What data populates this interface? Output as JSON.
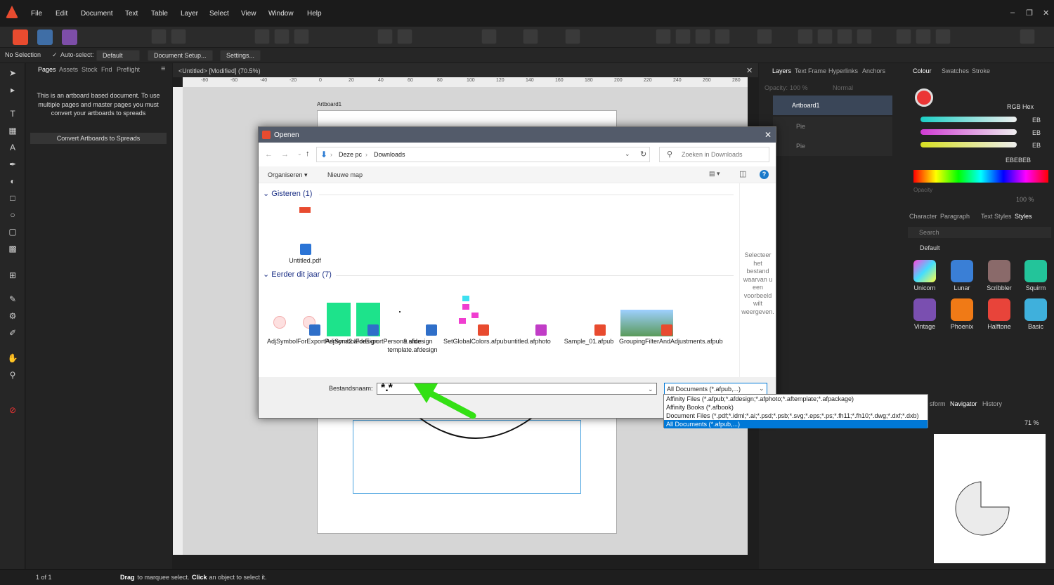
{
  "menu": [
    "File",
    "Edit",
    "Document",
    "Text",
    "Table",
    "Layer",
    "Select",
    "View",
    "Window",
    "Help"
  ],
  "context": {
    "status": "No Selection",
    "auto_select_label": "Auto-select:",
    "auto_select_value": "Default",
    "doc_setup": "Document Setup...",
    "settings": "Settings..."
  },
  "pages_panel": {
    "tabs": [
      "Pages",
      "Assets",
      "Stock",
      "Fnd",
      "Preflight"
    ],
    "info": "This is an artboard based document. To use multiple pages and master pages you must convert your artboards to spreads",
    "convert": "Convert Artboards to Spreads"
  },
  "canvas": {
    "doc_tab": "<Untitled> [Modified] (70.5%)",
    "artboard_label": "Artboard1"
  },
  "ruler_ticks": [
    "-80",
    "-60",
    "-40",
    "-20",
    "0",
    "20",
    "40",
    "60",
    "80",
    "100",
    "120",
    "140",
    "160",
    "180",
    "200",
    "220",
    "240",
    "260",
    "280"
  ],
  "layers_panel": {
    "tabs": [
      "Layers",
      "Text Frame",
      "Hyperlinks",
      "Anchors"
    ],
    "opacity_label": "Opacity:",
    "opacity_value": "100 %",
    "blend": "Normal",
    "items": [
      "Artboard1",
      "Pie",
      "Pie"
    ]
  },
  "colour_panel": {
    "tabs": [
      "Colour",
      "Swatches",
      "Stroke"
    ],
    "mode": "RGB Hex",
    "r": "EB",
    "g": "EB",
    "b": "EB",
    "hex": "EBEBEB",
    "opacity_label": "Opacity",
    "opacity_value": "100 %"
  },
  "styles_panel": {
    "tabs": [
      "Character",
      "Paragraph",
      "Text Styles",
      "Styles"
    ],
    "search_placeholder": "Search",
    "category": "Default",
    "items": [
      "Unicorn",
      "Lunar",
      "Scribbler",
      "Squirm",
      "Vintage",
      "Phoenix",
      "Halftone",
      "Basic"
    ]
  },
  "navigator_panel": {
    "tabs": [
      "sform",
      "Navigator",
      "History"
    ],
    "zoom": "71 %"
  },
  "statusbar": {
    "page": "1 of 1",
    "hint_drag": "Drag",
    "hint_mid": " to marquee select. ",
    "hint_click": "Click",
    "hint_end": " an object to select it."
  },
  "dialog": {
    "title": "Openen",
    "breadcrumb": [
      "Deze pc",
      "Downloads"
    ],
    "search_placeholder": "Zoeken in Downloads",
    "organize": "Organiseren",
    "new_folder": "Nieuwe map",
    "group1": "Gisteren (1)",
    "group2": "Eerder dit jaar (7)",
    "files_g1": [
      "Untitled.pdf"
    ],
    "files_g2": [
      "AdjSymbolForExportPersona2.afdesign",
      "AdjSymbolForExportPersona.afdesign",
      "9 slice template.afdesign",
      "SetGlobalColors.afpub",
      "untitled.afphoto",
      "Sample_01.afpub",
      "GroupingFilterAndAdjustments.afpub"
    ],
    "preview_text": "Selecteer het bestand waarvan u een voorbeeld wilt weergeven.",
    "filename_label": "Bestandsnaam:",
    "filename_value": "*.*",
    "filetype_value": "All Documents (*.afpub,...)",
    "filetype_options": [
      "Affinity Files (*.afpub;*.afdesign;*.afphoto;*.aftemplate;*.afpackage)",
      "Affinity Books (*.afbook)",
      "Document Files (*.pdf;*.idml;*.ai;*.psd;*.psb;*.svg;*.eps;*.ps;*.fh11;*.fh10;*.dwg;*.dxf;*.dxb)",
      "All Documents (*.afpub,...)"
    ]
  },
  "colors": {
    "accent": "#0078d7",
    "annotation_arrow": "#33e014",
    "brand": "#e84b2f"
  }
}
